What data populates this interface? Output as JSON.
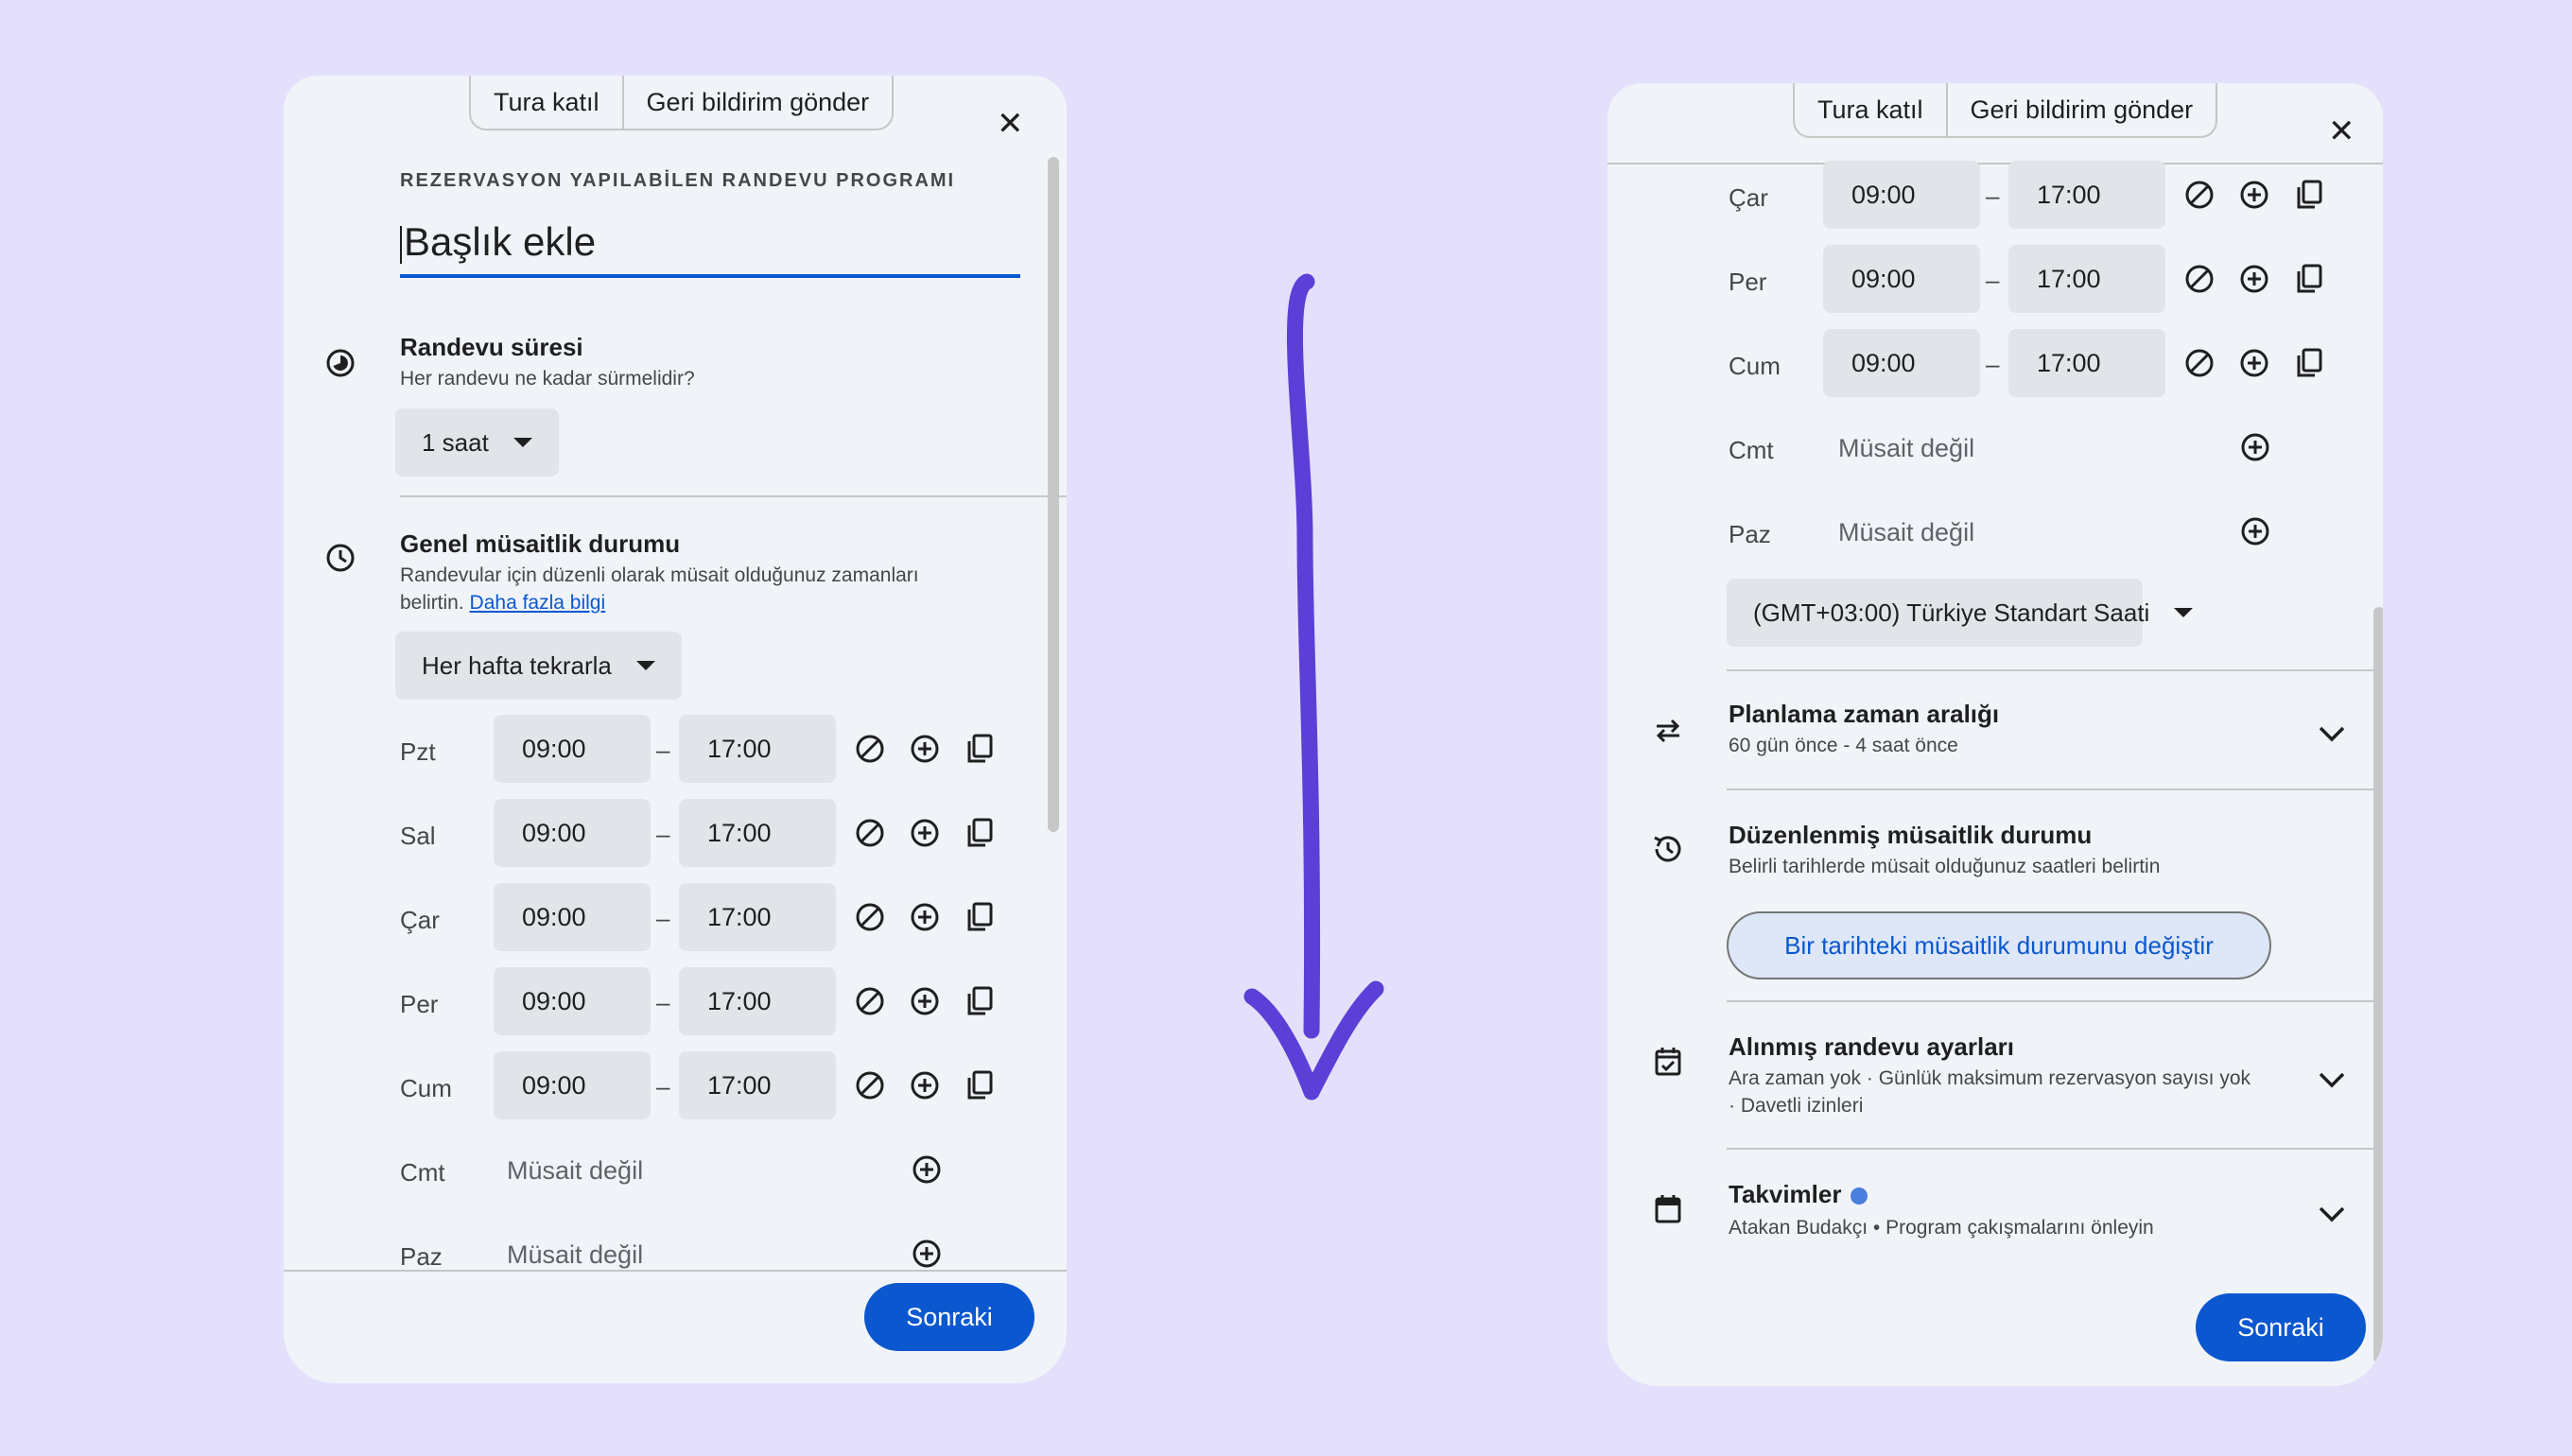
{
  "header": {
    "tour_label": "Tura katıl",
    "feedback_label": "Geri bildirim gönder",
    "close_label": "✕"
  },
  "left": {
    "overline": "REZERVASYON YAPILABİLEN RANDEVU PROGRAMI",
    "title_placeholder": "Başlık ekle",
    "duration": {
      "title": "Randevu süresi",
      "subtitle": "Her randevu ne kadar sürmelidir?",
      "value": "1 saat"
    },
    "availability": {
      "title": "Genel müsaitlik durumu",
      "subtitle_line1": "Randevular için düzenli olarak müsait olduğunuz zamanları",
      "subtitle_line2": "belirtin.",
      "learn_more": "Daha fazla bilgi",
      "repeat": "Her hafta tekrarla"
    },
    "days": [
      {
        "day": "Pzt",
        "start": "09:00",
        "end": "17:00"
      },
      {
        "day": "Sal",
        "start": "09:00",
        "end": "17:00"
      },
      {
        "day": "Çar",
        "start": "09:00",
        "end": "17:00"
      },
      {
        "day": "Per",
        "start": "09:00",
        "end": "17:00"
      },
      {
        "day": "Cum",
        "start": "09:00",
        "end": "17:00"
      },
      {
        "day": "Cmt",
        "unavailable": "Müsait değil"
      },
      {
        "day": "Paz",
        "unavailable": "Müsait değil"
      }
    ],
    "dash": "–",
    "next_label": "Sonraki"
  },
  "right": {
    "days": [
      {
        "day": "Çar",
        "start": "09:00",
        "end": "17:00"
      },
      {
        "day": "Per",
        "start": "09:00",
        "end": "17:00"
      },
      {
        "day": "Cum",
        "start": "09:00",
        "end": "17:00"
      },
      {
        "day": "Cmt",
        "unavailable": "Müsait değil"
      },
      {
        "day": "Paz",
        "unavailable": "Müsait değil"
      }
    ],
    "dash": "–",
    "timezone": "(GMT+03:00) Türkiye Standart Saati",
    "planning": {
      "title": "Planlama zaman aralığı",
      "subtitle": "60 gün önce - 4 saat önce"
    },
    "adjusted": {
      "title": "Düzenlenmiş müsaitlik durumu",
      "subtitle": "Belirli tarihlerde müsait olduğunuz saatleri belirtin",
      "button": "Bir tarihteki müsaitlik durumunu değiştir"
    },
    "booked": {
      "title": "Alınmış randevu ayarları",
      "subtitle_line1": "Ara zaman yok · Günlük maksimum rezervasyon sayısı yok",
      "subtitle_line2": "· Davetli izinleri"
    },
    "calendars": {
      "title": "Takvimler",
      "subtitle": "Atakan Budakçı • Program çakışmalarını önleyin"
    },
    "next_label": "Sonraki"
  },
  "icons": {
    "duration": "duration-icon",
    "availability": "clock-icon",
    "planning": "swap-arrows-icon",
    "adjusted": "history-icon",
    "booked": "event-check-icon",
    "calendars": "calendar-icon",
    "row_actions": [
      "block-icon",
      "add-circle-icon",
      "copy-icon"
    ],
    "arrow": "down-arrow-icon"
  },
  "colors": {
    "background": "#e4e0fc",
    "panel": "#f0f4f9",
    "accent": "#0b57d0",
    "arrow": "#5b3fd6"
  }
}
